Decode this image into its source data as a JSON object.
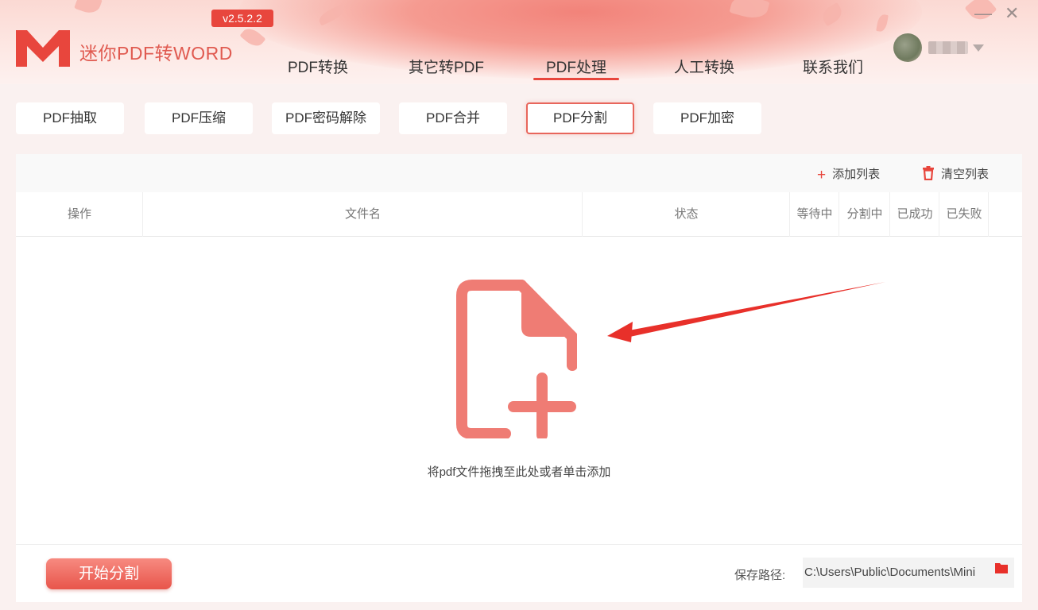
{
  "app": {
    "title": "迷你PDF转WORD",
    "version": "v2.5.2.2"
  },
  "nav": {
    "items": [
      {
        "label": "PDF转换",
        "active": false
      },
      {
        "label": "其它转PDF",
        "active": false
      },
      {
        "label": "PDF处理",
        "active": true
      },
      {
        "label": "人工转换",
        "active": false
      },
      {
        "label": "联系我们",
        "active": false
      }
    ]
  },
  "window": {
    "minimize": "—",
    "close": "✕"
  },
  "subtabs": [
    {
      "label": "PDF抽取",
      "active": false
    },
    {
      "label": "PDF压缩",
      "active": false
    },
    {
      "label": "PDF密码解除",
      "active": false
    },
    {
      "label": "PDF合并",
      "active": false
    },
    {
      "label": "PDF分割",
      "active": true
    },
    {
      "label": "PDF加密",
      "active": false
    }
  ],
  "toolbar": {
    "add_list": "添加列表",
    "clear_list": "清空列表"
  },
  "table": {
    "columns": [
      "操作",
      "文件名",
      "状态",
      "等待中",
      "分割中",
      "已成功",
      "已失败"
    ]
  },
  "dropzone": {
    "hint": "将pdf文件拖拽至此处或者单击添加"
  },
  "footer": {
    "start_button": "开始分割",
    "save_label": "保存路径:",
    "save_path": "C:\\Users\\Public\\Documents\\Mini"
  },
  "colors": {
    "accent": "#e8463d",
    "icon": "#ef7c74"
  }
}
